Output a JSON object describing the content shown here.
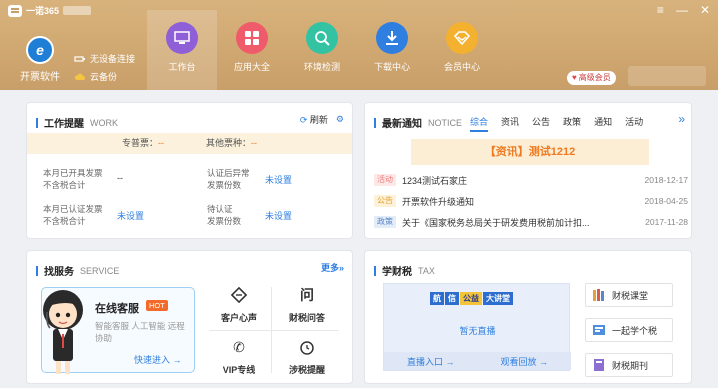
{
  "app": {
    "title": "一诺365",
    "window_controls": [
      "≡",
      "—",
      "✕"
    ]
  },
  "header": {
    "invoice_label": "开票软件",
    "device_status": "无设备连接",
    "cloud_backup": "云备份",
    "vip_label": "高级会员",
    "nav": [
      {
        "label": "工作台",
        "icon": "monitor-icon",
        "color": "#8e5fd6",
        "active": true
      },
      {
        "label": "应用大全",
        "icon": "apps-grid-icon",
        "color": "#ef5b6a",
        "active": false
      },
      {
        "label": "环境检测",
        "icon": "search-check-icon",
        "color": "#33c3a2",
        "active": false
      },
      {
        "label": "下载中心",
        "icon": "download-icon",
        "color": "#2f7fe0",
        "active": false
      },
      {
        "label": "会员中心",
        "icon": "member-diamond-icon",
        "color": "#f4b12f",
        "active": false
      }
    ]
  },
  "work": {
    "title": "工作提醒",
    "title_en": "WORK",
    "refresh": "刷新",
    "special_label": "专普票：",
    "special_value": "--",
    "other_label": "其他票种：",
    "other_value": "--",
    "row1_left_label_1": "本月已开具发票",
    "row1_left_label_2": "不含税合计",
    "row1_left_value": "--",
    "row1_right_label_1": "认证后异常",
    "row1_right_label_2": "发票份数",
    "row1_right_value": "未设置",
    "row2_left_label_1": "本月已认证发票",
    "row2_left_label_2": "不含税合计",
    "row2_left_value": "未设置",
    "row2_right_label_1": "待认证",
    "row2_right_label_2": "发票份数",
    "row2_right_value": "未设置"
  },
  "notice": {
    "title": "最新通知",
    "title_en": "NOTICE",
    "tabs": [
      "综合",
      "资讯",
      "公告",
      "政策",
      "通知",
      "活动"
    ],
    "banner": "【资讯】测试1212",
    "items": [
      {
        "tag": "活动",
        "text": "1234测试石家庄",
        "date": "2018-12-17",
        "tag_color": "#f07d7d",
        "tag_bg": "#fde8e8"
      },
      {
        "tag": "公告",
        "text": "开票软件升级通知",
        "date": "2018-04-25",
        "tag_color": "#e8a02a",
        "tag_bg": "#fdf1da"
      },
      {
        "tag": "政策",
        "text": "关于《国家税务总局关于研发费用税前加计扣...",
        "date": "2017-11-28",
        "tag_color": "#5a86c8",
        "tag_bg": "#e3ecf9"
      }
    ]
  },
  "service": {
    "title": "找服务",
    "title_en": "SERVICE",
    "more": "更多",
    "cs_title": "在线客服",
    "cs_hot": "HOT",
    "cs_desc": "智能客服 人工智能 远程协助",
    "cs_link": "快速进入",
    "items": [
      {
        "label": "客户心声",
        "icon": "feedback-icon"
      },
      {
        "label": "财税问答",
        "icon": "qa-icon"
      },
      {
        "label": "VIP专线",
        "icon": "phone-icon"
      },
      {
        "label": "涉税提醒",
        "icon": "alarm-clock-icon"
      }
    ]
  },
  "learn": {
    "title": "学财税",
    "title_en": "TAX",
    "video_logo": [
      "航",
      "信",
      "公益",
      "大讲堂"
    ],
    "video_status": "暂无直播",
    "live_entry": "直播入口",
    "replay": "观看回放",
    "buttons": [
      {
        "label": "财税课堂",
        "icon": "books-icon"
      },
      {
        "label": "一起学个税",
        "icon": "tax-learn-icon"
      },
      {
        "label": "财税期刊",
        "icon": "journal-icon"
      }
    ]
  }
}
